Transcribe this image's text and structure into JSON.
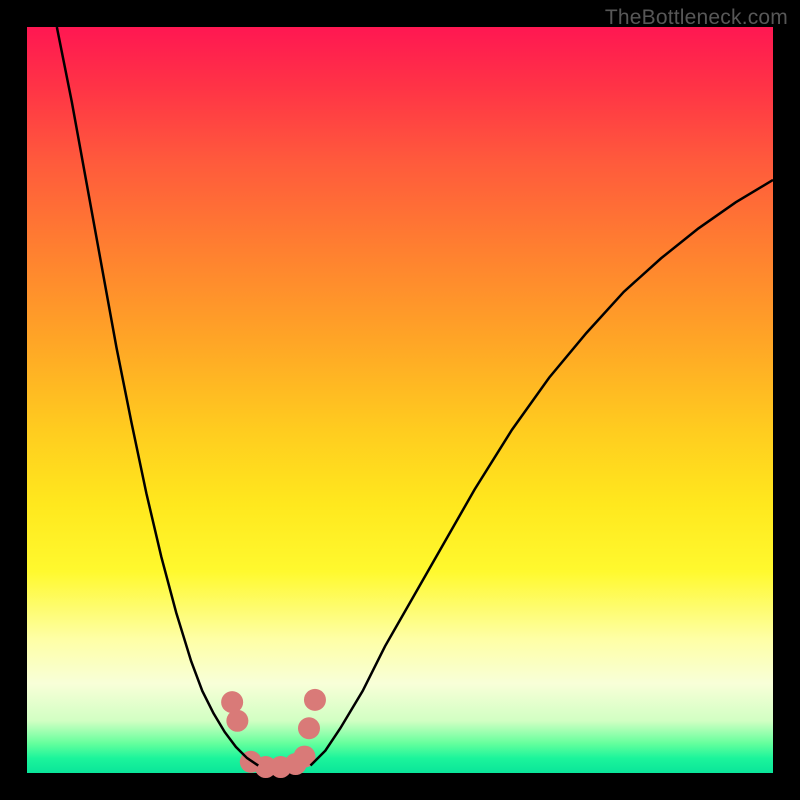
{
  "watermark": "TheBottleneck.com",
  "chart_data": {
    "type": "line",
    "title": "",
    "xlabel": "",
    "ylabel": "",
    "xlim": [
      0,
      100
    ],
    "ylim": [
      0,
      100
    ],
    "grid": false,
    "legend": false,
    "series": [
      {
        "name": "left-curve",
        "stroke": "#000000",
        "stroke_width": 2.5,
        "x": [
          4,
          6,
          8,
          10,
          12,
          14,
          16,
          18,
          20,
          22,
          23.5,
          25,
          26.5,
          28,
          29.5,
          31
        ],
        "y": [
          100,
          90,
          79,
          68,
          57,
          47,
          37.5,
          29,
          21.5,
          15,
          11,
          8,
          5.5,
          3.5,
          2,
          1
        ]
      },
      {
        "name": "right-curve",
        "stroke": "#000000",
        "stroke_width": 2.5,
        "x": [
          38,
          40,
          42,
          45,
          48,
          52,
          56,
          60,
          65,
          70,
          75,
          80,
          85,
          90,
          95,
          100
        ],
        "y": [
          1,
          3,
          6,
          11,
          17,
          24,
          31,
          38,
          46,
          53,
          59,
          64.5,
          69,
          73,
          76.5,
          79.5
        ]
      },
      {
        "name": "dots-cluster",
        "type": "scatter",
        "color": "#d97a78",
        "radius": 11,
        "x": [
          27.5,
          28.2,
          30,
          32,
          34,
          36,
          37.2,
          37.8,
          38.6
        ],
        "y": [
          9.5,
          7,
          1.5,
          0.8,
          0.8,
          1.2,
          2.2,
          6,
          9.8
        ]
      }
    ],
    "gradient_stops": [
      {
        "pos": 0.0,
        "color": "#ff1752"
      },
      {
        "pos": 0.08,
        "color": "#ff3346"
      },
      {
        "pos": 0.18,
        "color": "#ff5a3c"
      },
      {
        "pos": 0.3,
        "color": "#ff8030"
      },
      {
        "pos": 0.42,
        "color": "#ffa526"
      },
      {
        "pos": 0.54,
        "color": "#ffcc1f"
      },
      {
        "pos": 0.64,
        "color": "#ffe81e"
      },
      {
        "pos": 0.73,
        "color": "#fff92e"
      },
      {
        "pos": 0.82,
        "color": "#feffa5"
      },
      {
        "pos": 0.88,
        "color": "#f8ffd8"
      },
      {
        "pos": 0.93,
        "color": "#d2ffc3"
      },
      {
        "pos": 0.96,
        "color": "#66ff9d"
      },
      {
        "pos": 0.98,
        "color": "#1cf59b"
      },
      {
        "pos": 1.0,
        "color": "#0ae59a"
      }
    ]
  }
}
